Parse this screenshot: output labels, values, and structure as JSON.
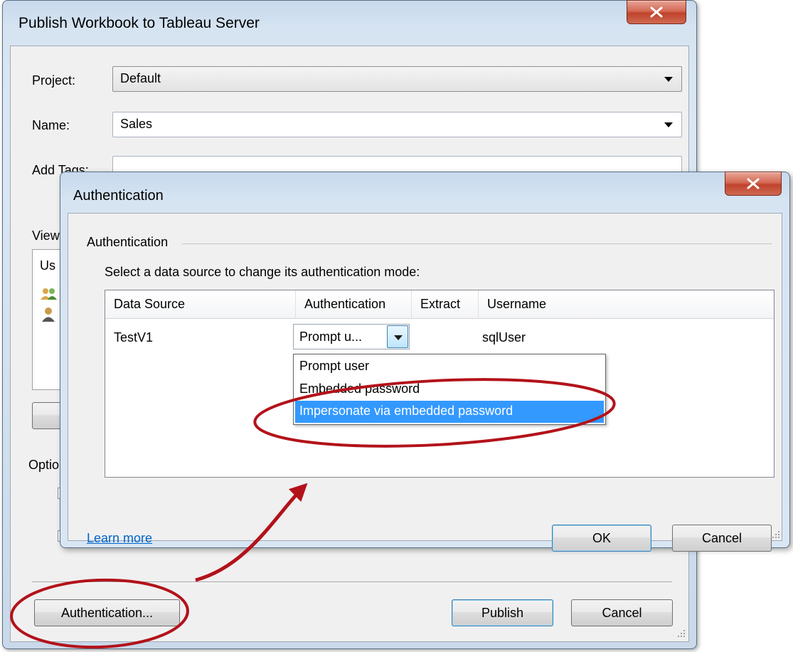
{
  "publish_dialog": {
    "title": "Publish Workbook to Tableau Server",
    "project_label": "Project:",
    "project_value": "Default",
    "name_label": "Name:",
    "name_value": "Sales",
    "tags_label": "Add Tags:",
    "tags_value": "",
    "views_label": "View",
    "users_header": "Us",
    "options_label": "Optio",
    "authentication_button": "Authentication...",
    "publish_button": "Publish",
    "cancel_button": "Cancel"
  },
  "auth_dialog": {
    "title": "Authentication",
    "group_label": "Authentication",
    "instruction": "Select a data source to change its authentication mode:",
    "columns": [
      "Data Source",
      "Authentication",
      "Extract",
      "Username"
    ],
    "rows": [
      {
        "data_source": "TestV1",
        "authentication": "Prompt u...",
        "extract": "",
        "username": "sqlUser"
      }
    ],
    "dropdown_options": [
      "Prompt user",
      "Embedded password",
      "Impersonate via embedded password"
    ],
    "selected_option_index": 2,
    "learn_more": "Learn more",
    "ok_button": "OK",
    "cancel_button": "Cancel"
  },
  "colors": {
    "annotation_red": "#b3121a",
    "selection_blue": "#3399ff",
    "link_blue": "#0066cc"
  }
}
